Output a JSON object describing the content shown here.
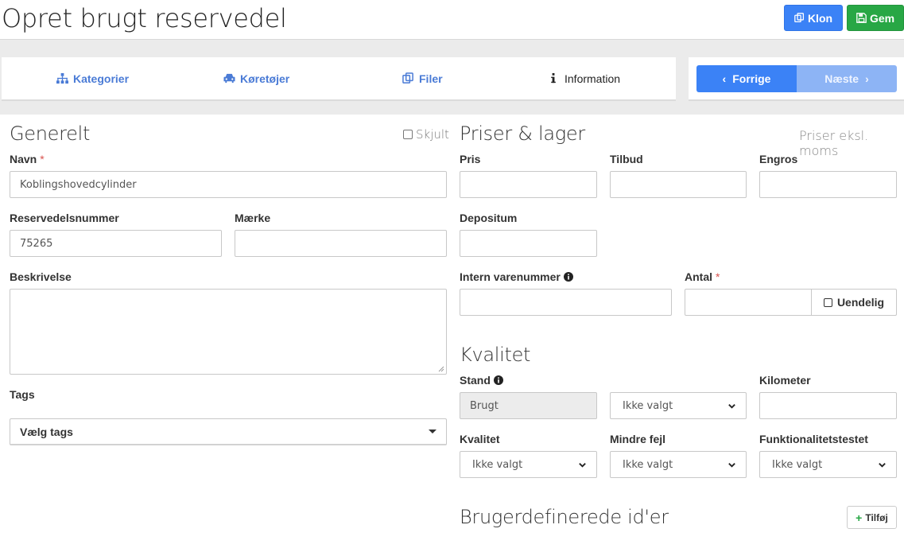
{
  "page": {
    "title": "Opret brugt reservedel"
  },
  "toolbar": {
    "clone_label": "Klon",
    "save_label": "Gem"
  },
  "tabs": [
    {
      "label": "Kategorier",
      "icon": "sitemap-icon"
    },
    {
      "label": "Køretøjer",
      "icon": "car-icon"
    },
    {
      "label": "Filer",
      "icon": "copy-icon"
    },
    {
      "label": "Information",
      "icon": "info-icon",
      "active": true
    }
  ],
  "nav": {
    "prev_label": "Forrige",
    "next_label": "Næste"
  },
  "general": {
    "title": "Generelt",
    "hide_label": "Skjult",
    "name_label": "Navn",
    "required_mark": "*",
    "name_value": "Koblingshovedcylinder",
    "part_number_label": "Reservedelsnummer",
    "part_number_value": "75265",
    "brand_label": "Mærke",
    "brand_value": "",
    "description_label": "Beskrivelse",
    "tags_label": "Tags",
    "tags_placeholder": "Vælg tags"
  },
  "prices": {
    "title": "Priser & lager",
    "hint": "Priser eksl. moms",
    "price_label": "Pris",
    "offer_label": "Tilbud",
    "wholesale_label": "Engros",
    "deposit_label": "Depositum",
    "internal_number_label": "Intern varenummer",
    "quantity_label": "Antal",
    "infinite_label": "Uendelig"
  },
  "quality": {
    "title": "Kvalitet",
    "condition_label": "Stand",
    "condition_value": "Brugt",
    "condition_select": "Ikke valgt",
    "km_label": "Kilometer",
    "quality_label": "Kvalitet",
    "quality_value": "Ikke valgt",
    "minor_faults_label": "Mindre fejl",
    "minor_faults_value": "Ikke valgt",
    "functional_label": "Funktionalitetstestet",
    "functional_value": "Ikke valgt"
  },
  "custom_ids": {
    "title": "Brugerdefinerede id'er",
    "add_label": "Tilføj"
  },
  "colors": {
    "primary": "#3b82f6",
    "success": "#28a745",
    "link": "#4a7bd6",
    "required": "#d9534f"
  }
}
